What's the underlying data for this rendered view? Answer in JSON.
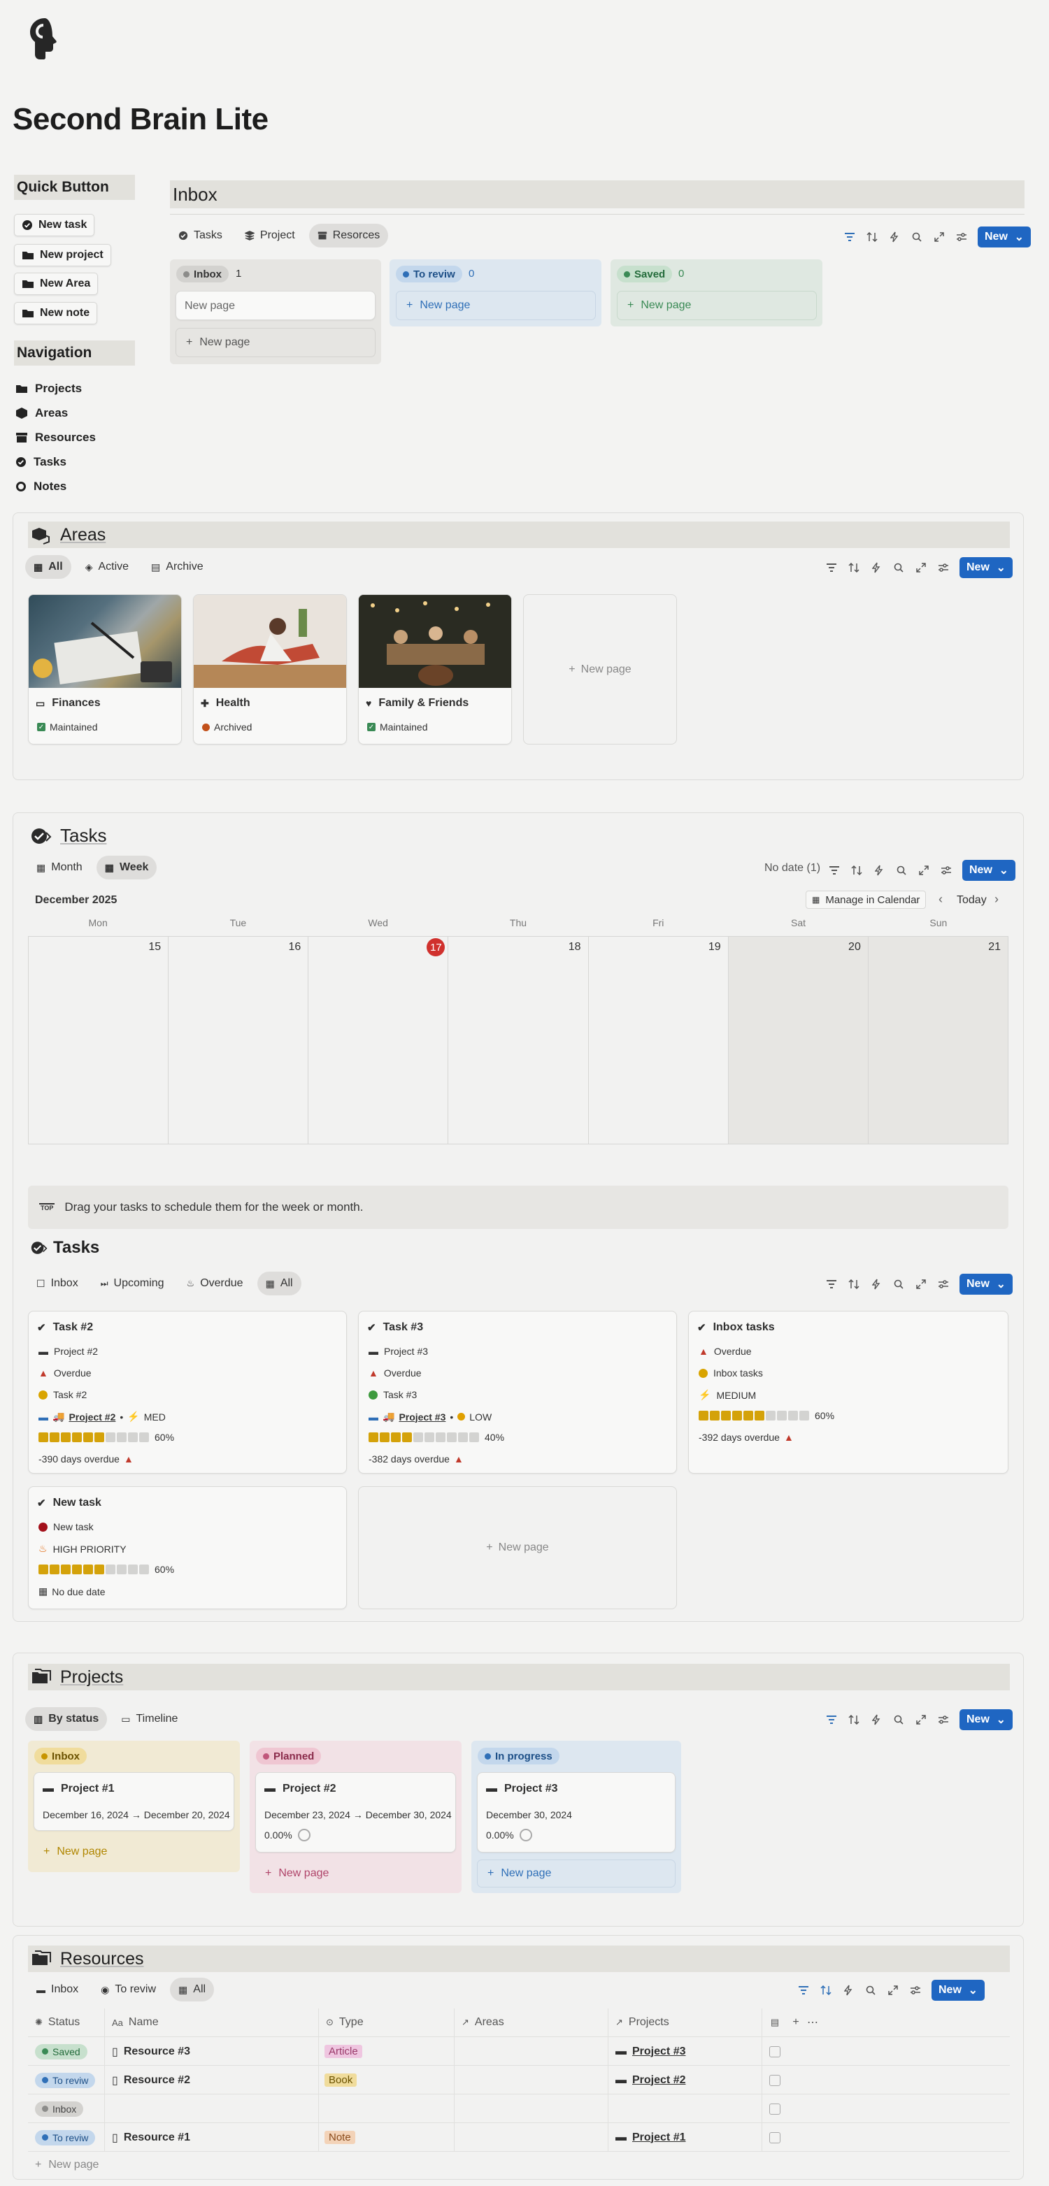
{
  "page": {
    "title": "Second Brain Lite"
  },
  "quick": {
    "heading": "Quick Button",
    "buttons": [
      "New task",
      "New project",
      "New Area",
      "New note"
    ]
  },
  "nav": {
    "heading": "Navigation",
    "items": [
      "Projects",
      "Areas",
      "Resources",
      "Tasks",
      "Notes"
    ]
  },
  "inbox": {
    "title": "Inbox",
    "tabs": [
      "Tasks",
      "Project",
      "Resorces"
    ],
    "new": "New",
    "columns": [
      {
        "label": "Inbox",
        "count": "1",
        "color": "#8c8c8a",
        "bg": "#e6e5e2",
        "pillbg": "#d3d2cf"
      },
      {
        "label": "To reviw",
        "count": "0",
        "color": "#2f6fb7",
        "bg": "#dde7f0",
        "pillbg": "#c3d7ec"
      },
      {
        "label": "Saved",
        "count": "0",
        "color": "#3a8a55",
        "bg": "#dfe8e1",
        "pillbg": "#c7e0cd"
      }
    ],
    "card_placeholder": "New page",
    "new_page": "New page"
  },
  "areas": {
    "title": "Areas",
    "tabs": [
      "All",
      "Active",
      "Archive"
    ],
    "new": "New",
    "cards": [
      {
        "name": "Finances",
        "status": "Maintained",
        "icon": "id-card-icon"
      },
      {
        "name": "Health",
        "status": "Archived",
        "icon": "medkit-icon"
      },
      {
        "name": "Family & Friends",
        "status": "Maintained",
        "icon": "heart-icon"
      }
    ],
    "new_page": "New page"
  },
  "tasks_cal": {
    "title": "Tasks",
    "tabs": [
      "Month",
      "Week"
    ],
    "no_date": "No date (1)",
    "new": "New",
    "month": "December 2025",
    "manage": "Manage in Calendar",
    "today": "Today",
    "days": [
      "Mon",
      "Tue",
      "Wed",
      "Thu",
      "Fri",
      "Sat",
      "Sun"
    ],
    "dates": [
      "15",
      "16",
      "17",
      "18",
      "19",
      "20",
      "21"
    ],
    "tip": "Drag your tasks to schedule them for the week or month.",
    "tip_badge": "TOP"
  },
  "tasks": {
    "title": "Tasks",
    "tabs": [
      "Inbox",
      "Upcoming",
      "Overdue",
      "All"
    ],
    "new": "New",
    "cards": [
      {
        "name": "Task #2",
        "project": "Project #2",
        "status": "Overdue",
        "label": "Task #2",
        "rel": "Project #2",
        "priority": "MED",
        "progress": 0.6,
        "pct": "60%",
        "due": "-390 days overdue",
        "dot": "#d9a400"
      },
      {
        "name": "Task #3",
        "project": "Project #3",
        "status": "Overdue",
        "label": "Task #3",
        "rel": "Project #3",
        "priority": "LOW",
        "progress": 0.4,
        "pct": "40%",
        "due": "-382 days overdue",
        "dot": "#3e9a3e"
      },
      {
        "name": "Inbox tasks",
        "status": "Overdue",
        "label": "Inbox tasks",
        "priority": "MEDIUM",
        "progress": 0.6,
        "pct": "60%",
        "due": "-392 days overdue",
        "dot": "#d9a400"
      },
      {
        "name": "New task",
        "label": "New task",
        "priority": "HIGH PRIORITY",
        "progress": 0.6,
        "pct": "60%",
        "due": "No due date",
        "dot": "#a3101a"
      }
    ],
    "new_page": "New page"
  },
  "projects": {
    "title": "Projects",
    "tabs": [
      "By status",
      "Timeline"
    ],
    "new": "New",
    "columns": [
      {
        "label": "Inbox",
        "bg": "#f1ead4",
        "pillbg": "#f0dc9c",
        "color": "#c79400",
        "text": "#8a6a00",
        "card": {
          "name": "Project #1",
          "dates": "December 16, 2024 → December 20, 2024"
        }
      },
      {
        "label": "Planned",
        "bg": "#f2e2e6",
        "pillbg": "#efc6d2",
        "color": "#c0567a",
        "text": "#a6405f",
        "card": {
          "name": "Project #2",
          "dates": "December 23, 2024 → December 30, 2024",
          "progress": "0.00%"
        }
      },
      {
        "label": "In progress",
        "bg": "#dde7f0",
        "pillbg": "#c3d7ec",
        "color": "#2f6fb7",
        "text": "#2f6fb7",
        "card": {
          "name": "Project #3",
          "dates": "December 30, 2024",
          "progress": "0.00%"
        }
      }
    ],
    "new_page": "New page"
  },
  "resources": {
    "title": "Resources",
    "tabs": [
      "Inbox",
      "To reviw",
      "All"
    ],
    "new": "New",
    "headers": [
      "Status",
      "Name",
      "Type",
      "Areas",
      "Projects"
    ],
    "rows": [
      {
        "status": "Saved",
        "name": "Resource #3",
        "type": "Article",
        "project": "Project #3"
      },
      {
        "status": "To reviw",
        "name": "Resource #2",
        "type": "Book",
        "project": "Project #2"
      },
      {
        "status": "Inbox",
        "name": "",
        "type": "",
        "project": ""
      },
      {
        "status": "To reviw",
        "name": "Resource #1",
        "type": "Note",
        "project": "Project #1"
      }
    ],
    "new_page": "New page"
  }
}
